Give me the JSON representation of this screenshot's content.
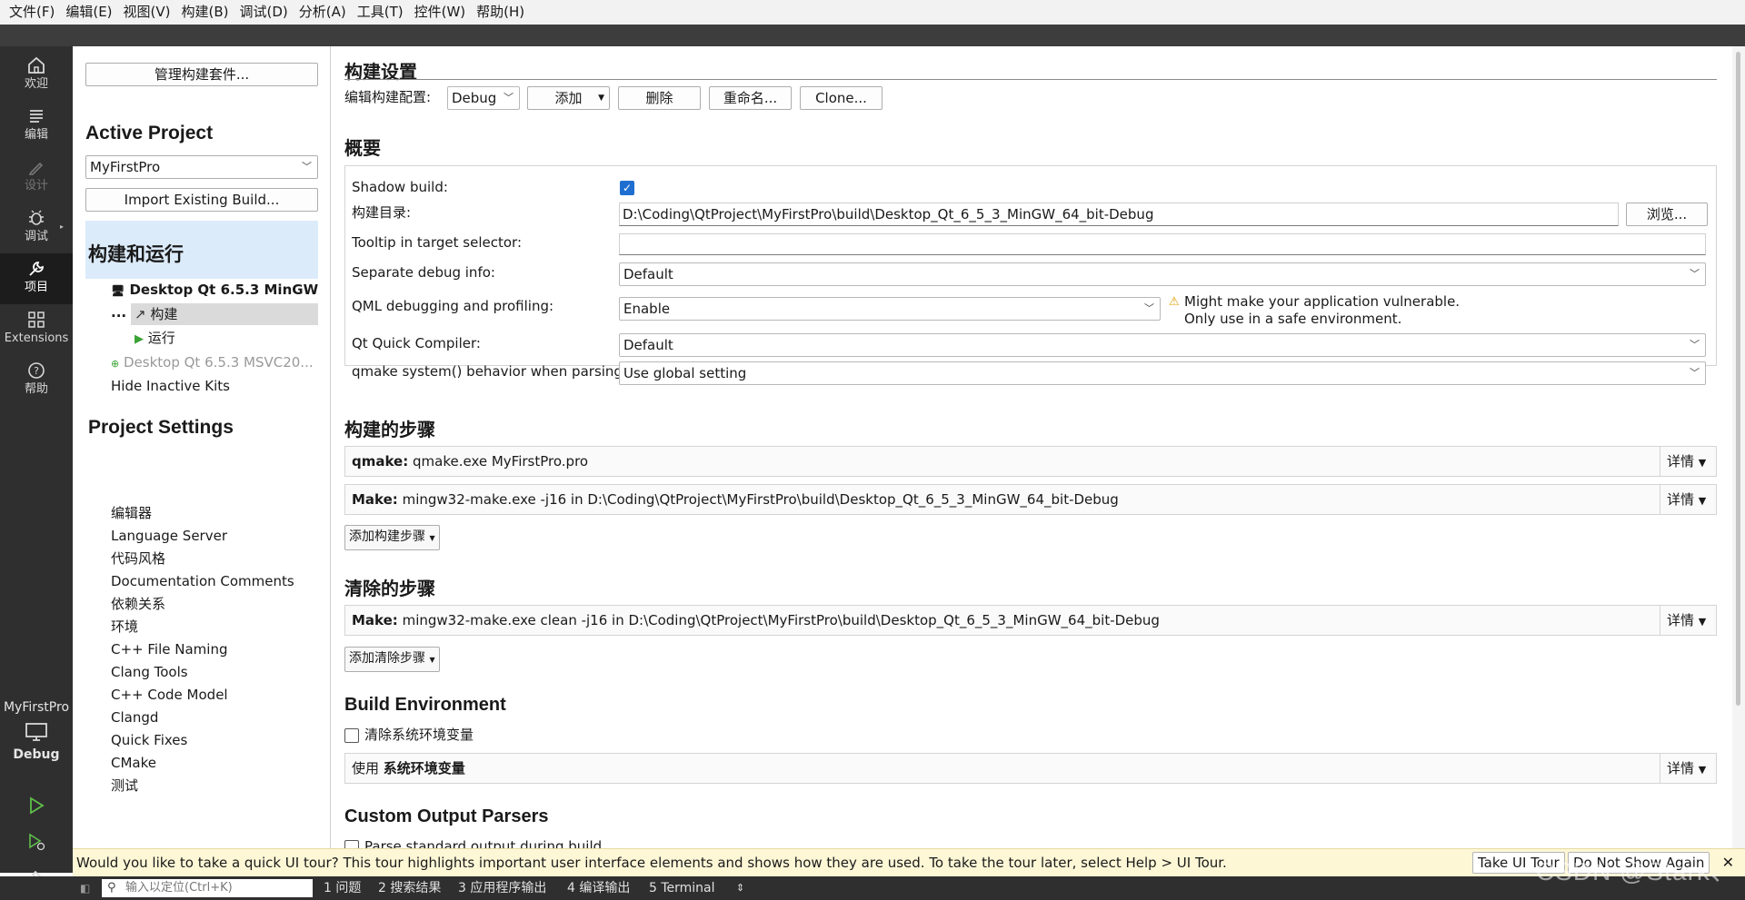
{
  "menu": [
    "文件(F)",
    "编辑(E)",
    "视图(V)",
    "构建(B)",
    "调试(D)",
    "分析(A)",
    "工具(T)",
    "控件(W)",
    "帮助(H)"
  ],
  "modes": [
    {
      "label": "欢迎",
      "icon": "home-icon"
    },
    {
      "label": "编辑",
      "icon": "edit-icon"
    },
    {
      "label": "设计",
      "icon": "design-icon"
    },
    {
      "label": "调试",
      "icon": "bug-icon"
    },
    {
      "label": "项目",
      "icon": "wrench-icon"
    },
    {
      "label": "Extensions",
      "icon": "extensions-icon"
    },
    {
      "label": "帮助",
      "icon": "help-icon"
    }
  ],
  "kit_selector": {
    "project": "MyFirstPro",
    "config": "Debug"
  },
  "sidebar": {
    "manage_kits": "管理构建套件...",
    "active_project_heading": "Active Project",
    "active_project": "MyFirstPro",
    "import_build": "Import Existing Build...",
    "build_run_heading": "构建和运行",
    "kit_active": "Desktop Qt 6.5.3 MinGW ...",
    "kit_build": "构建",
    "kit_run": "运行",
    "kit_inactive": "Desktop Qt 6.5.3 MSVC20...",
    "hide_inactive": "Hide Inactive Kits",
    "project_settings_heading": "Project Settings",
    "settings": [
      "编辑器",
      "Language Server",
      "代码风格",
      "Documentation Comments",
      "依赖关系",
      "环境",
      "C++ File Naming",
      "Clang Tools",
      "C++ Code Model",
      "Clangd",
      "Quick Fixes",
      "CMake",
      "测试"
    ]
  },
  "main": {
    "build_settings_title": "构建设置",
    "edit_config_label": "编辑构建配置:",
    "config_value": "Debug",
    "add_btn": "添加",
    "delete_btn": "删除",
    "rename_btn": "重命名...",
    "clone_btn": "Clone...",
    "overview_title": "概要",
    "shadow_build_label": "Shadow build:",
    "build_dir_label": "构建目录:",
    "build_dir": "D:\\Coding\\QtProject\\MyFirstPro\\build\\Desktop_Qt_6_5_3_MinGW_64_bit-Debug",
    "browse_btn": "浏览...",
    "tooltip_label": "Tooltip in target selector:",
    "tooltip_value": "",
    "sep_debug_label": "Separate debug info:",
    "sep_debug_value": "Default",
    "qml_label": "QML debugging and profiling:",
    "qml_value": "Enable",
    "qml_warning_1": "Might make your application vulnerable.",
    "qml_warning_2": "Only use in a safe environment.",
    "qtquick_label": "Qt Quick Compiler:",
    "qtquick_value": "Default",
    "qmake_label": "qmake system() behavior when parsing:",
    "qmake_value": "Use global setting",
    "build_steps_title": "构建的步骤",
    "step_qmake_key": "qmake:",
    "step_qmake_val": "qmake.exe MyFirstPro.pro",
    "step_make_key": "Make:",
    "step_make_val": "mingw32-make.exe -j16 in D:\\Coding\\QtProject\\MyFirstPro\\build\\Desktop_Qt_6_5_3_MinGW_64_bit-Debug",
    "details": "详情",
    "add_build_step": "添加构建步骤",
    "clean_steps_title": "清除的步骤",
    "clean_make_key": "Make:",
    "clean_make_val": "mingw32-make.exe clean -j16 in D:\\Coding\\QtProject\\MyFirstPro\\build\\Desktop_Qt_6_5_3_MinGW_64_bit-Debug",
    "add_clean_step": "添加清除步骤",
    "build_env_title": "Build Environment",
    "clear_env_label": "清除系统环境变量",
    "use_env_prefix": "使用",
    "use_env_bold": "系统环境变量",
    "custom_parsers_title": "Custom Output Parsers",
    "parse_std_output": "Parse standard output during build"
  },
  "tour": {
    "text": "Would you like to take a quick UI tour? This tour highlights important user interface elements and shows how they are used. To take the tour later, select Help > UI Tour.",
    "take": "Take UI Tour",
    "dont_show": "Do Not Show Again"
  },
  "status": {
    "locator_placeholder": "输入以定位(Ctrl+K)",
    "panes": [
      "1 问题",
      "2 搜索结果",
      "3 应用程序输出",
      "4 编译输出",
      "5 Terminal"
    ]
  },
  "watermark": "CSDN @Stark、",
  "colors": {
    "accent": "#1f6fd0",
    "sidebar_selection": "#dcebfa",
    "modebar": "#2f2f2f",
    "tour_bg": "#fdf7d6"
  }
}
